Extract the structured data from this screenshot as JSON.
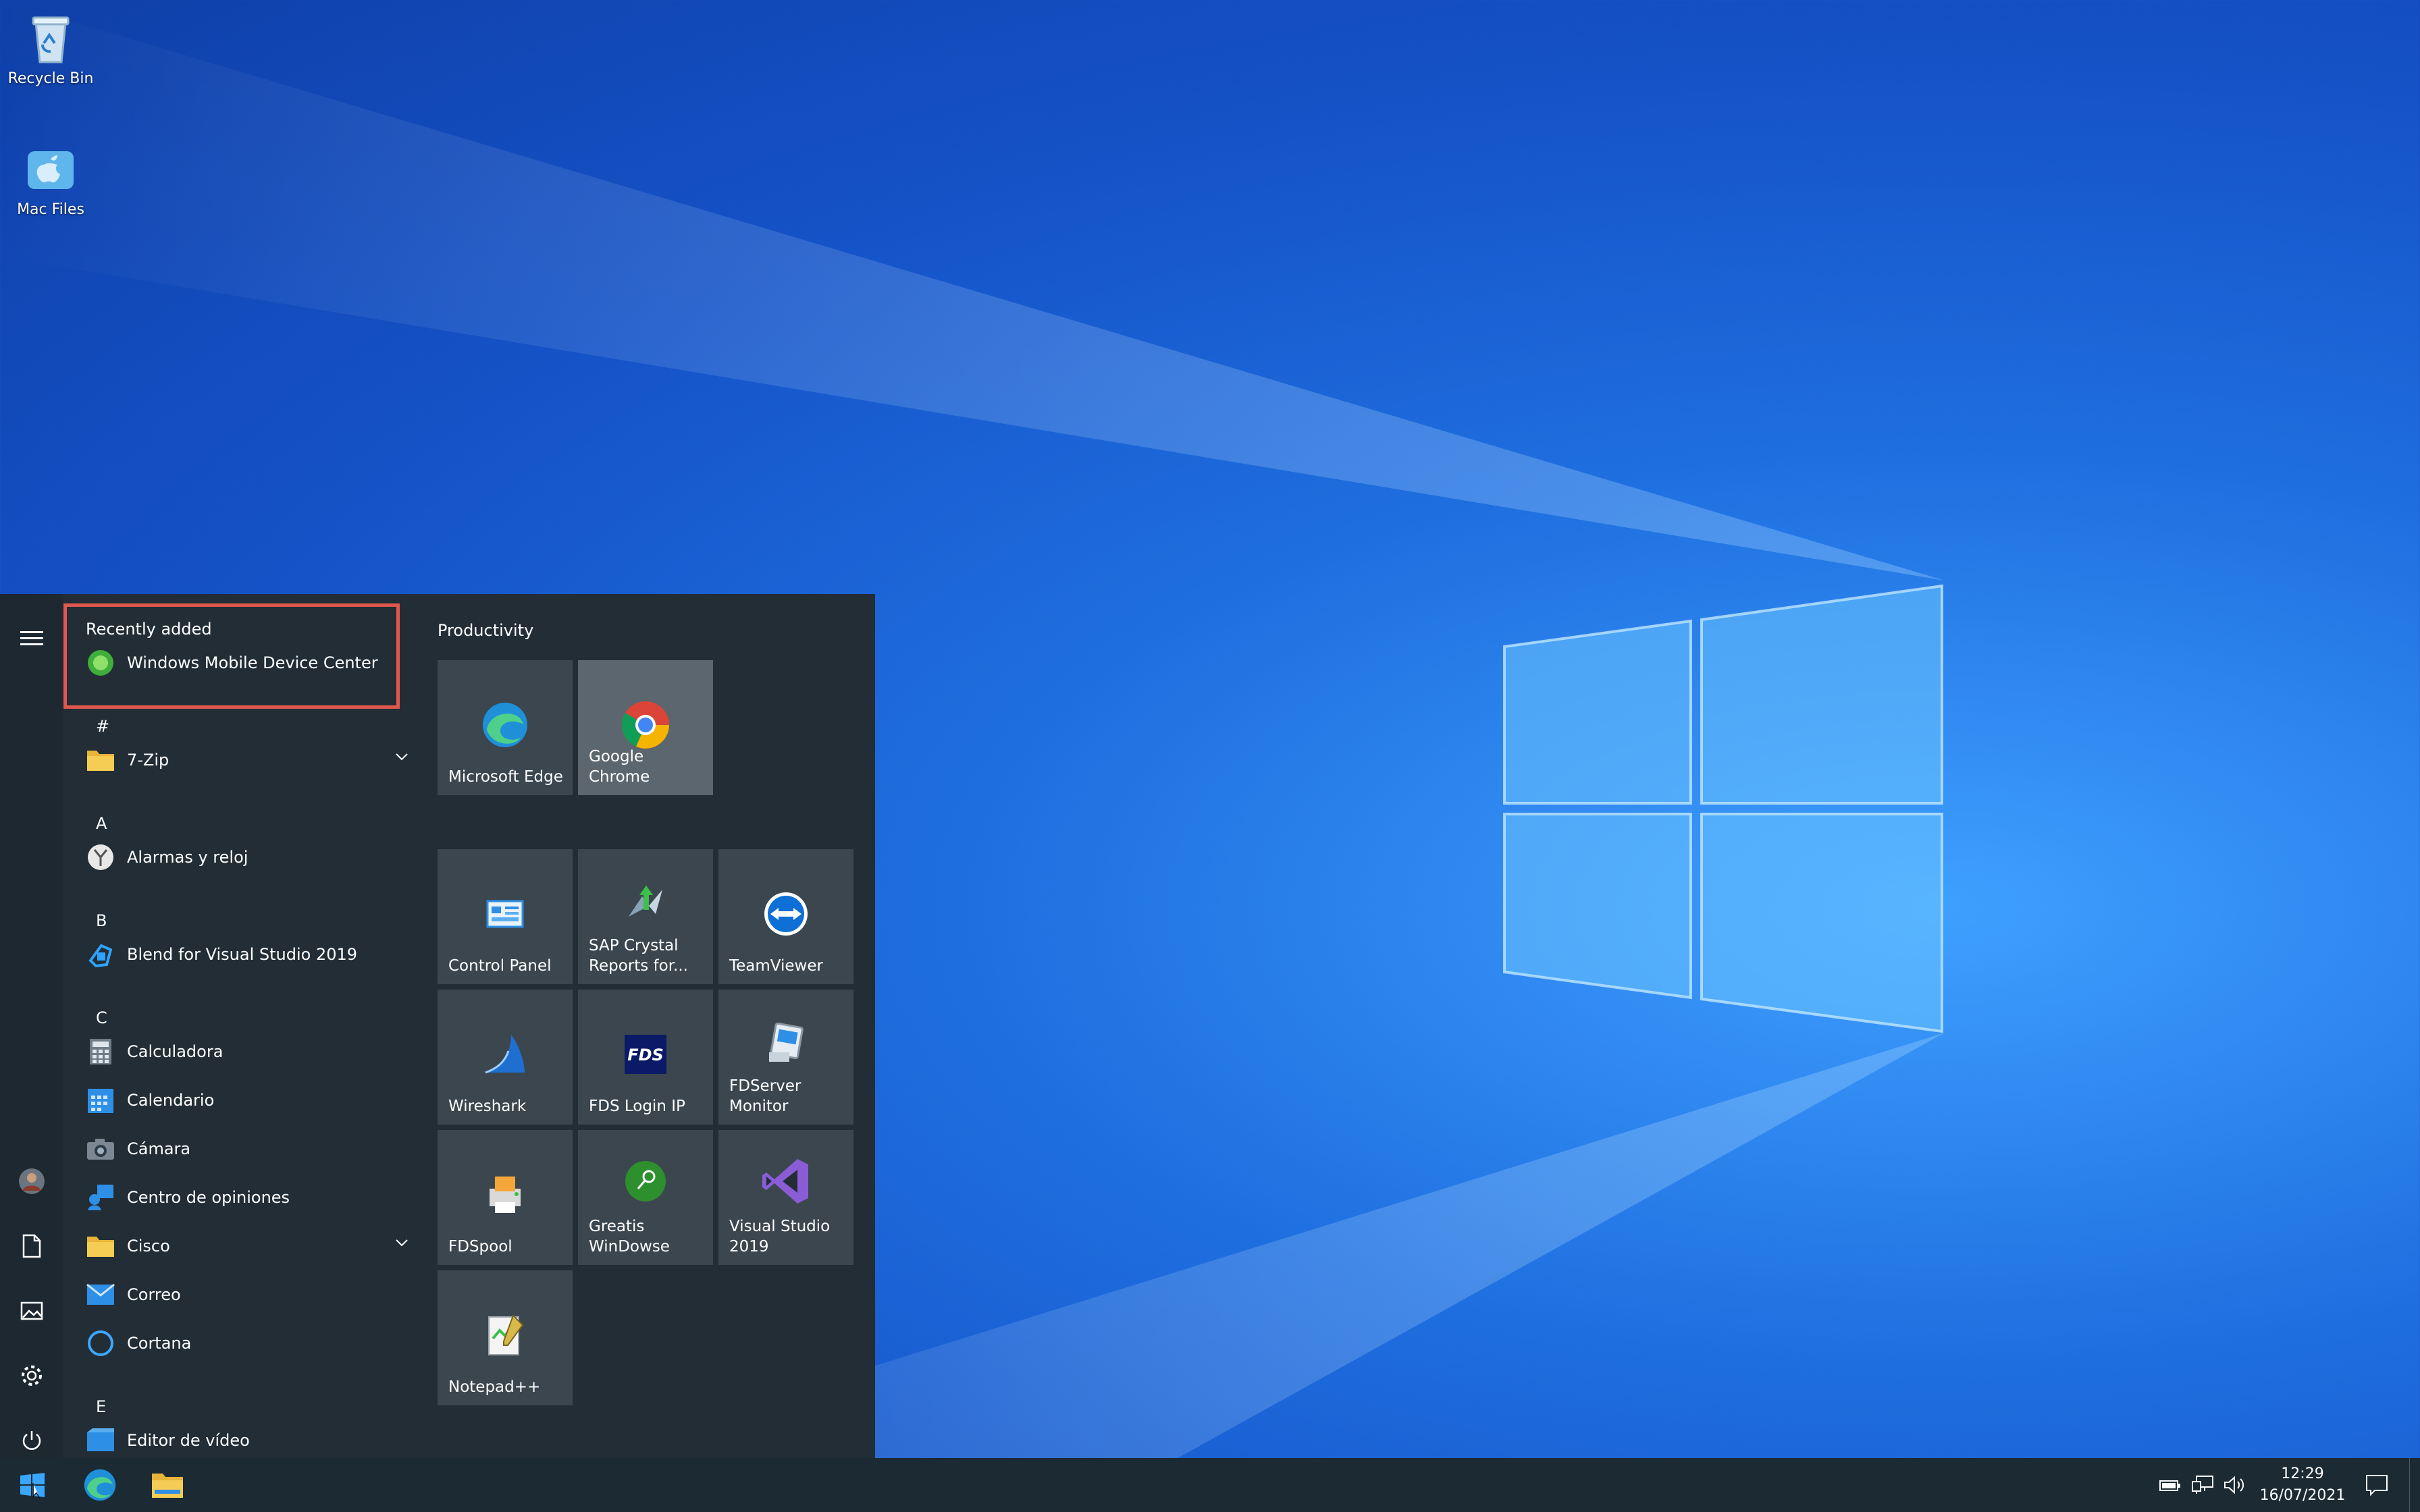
{
  "desktop": {
    "icons": [
      {
        "label": "Recycle Bin",
        "icon": "recycle-bin-icon"
      },
      {
        "label": "Mac Files",
        "icon": "mac-drive-icon"
      }
    ]
  },
  "start_menu": {
    "recently_added": {
      "title": "Recently added",
      "items": [
        {
          "label": "Windows Mobile Device Center",
          "icon": "device-center-icon"
        }
      ]
    },
    "letters": [
      "#",
      "A",
      "B",
      "C",
      "E"
    ],
    "apps": [
      {
        "label": "7-Zip",
        "icon": "folder-icon",
        "expandable": true
      },
      {
        "label": "Alarmas y reloj",
        "icon": "alarm-clock-icon"
      },
      {
        "label": "Blend for Visual Studio 2019",
        "icon": "blend-icon"
      },
      {
        "label": "Calculadora",
        "icon": "calculator-icon"
      },
      {
        "label": "Calendario",
        "icon": "calendar-icon"
      },
      {
        "label": "Cámara",
        "icon": "camera-icon"
      },
      {
        "label": "Centro de opiniones",
        "icon": "feedback-icon"
      },
      {
        "label": "Cisco",
        "icon": "folder-icon",
        "expandable": true
      },
      {
        "label": "Correo",
        "icon": "mail-icon"
      },
      {
        "label": "Cortana",
        "icon": "cortana-icon"
      },
      {
        "label": "Editor de vídeo",
        "icon": "video-editor-icon"
      }
    ],
    "tiles": {
      "group_title": "Productivity",
      "items": [
        {
          "label": "Microsoft Edge",
          "icon": "edge-icon"
        },
        {
          "label": "Google Chrome",
          "icon": "chrome-icon"
        },
        {
          "label": "Control Panel",
          "icon": "control-panel-icon"
        },
        {
          "label": "SAP Crystal\nReports for...",
          "icon": "sap-crystal-icon"
        },
        {
          "label": "TeamViewer",
          "icon": "teamviewer-icon"
        },
        {
          "label": "Wireshark",
          "icon": "wireshark-icon"
        },
        {
          "label": "FDS Login IP",
          "icon": "fds-icon"
        },
        {
          "label": "FDServer\nMonitor",
          "icon": "fdserver-icon"
        },
        {
          "label": "FDSpool",
          "icon": "fdspool-icon"
        },
        {
          "label": "Greatis\nWinDowse",
          "icon": "windowse-icon"
        },
        {
          "label": "Visual Studio\n2019",
          "icon": "visual-studio-icon"
        },
        {
          "label": "Notepad++",
          "icon": "notepadpp-icon"
        }
      ]
    }
  },
  "taskbar": {
    "clock_time": "12:29",
    "clock_date": "16/07/2021"
  },
  "colors": {
    "highlight_border": "#e0584c",
    "start_bg": "#222d36",
    "tile_bg": "#3b464f"
  }
}
